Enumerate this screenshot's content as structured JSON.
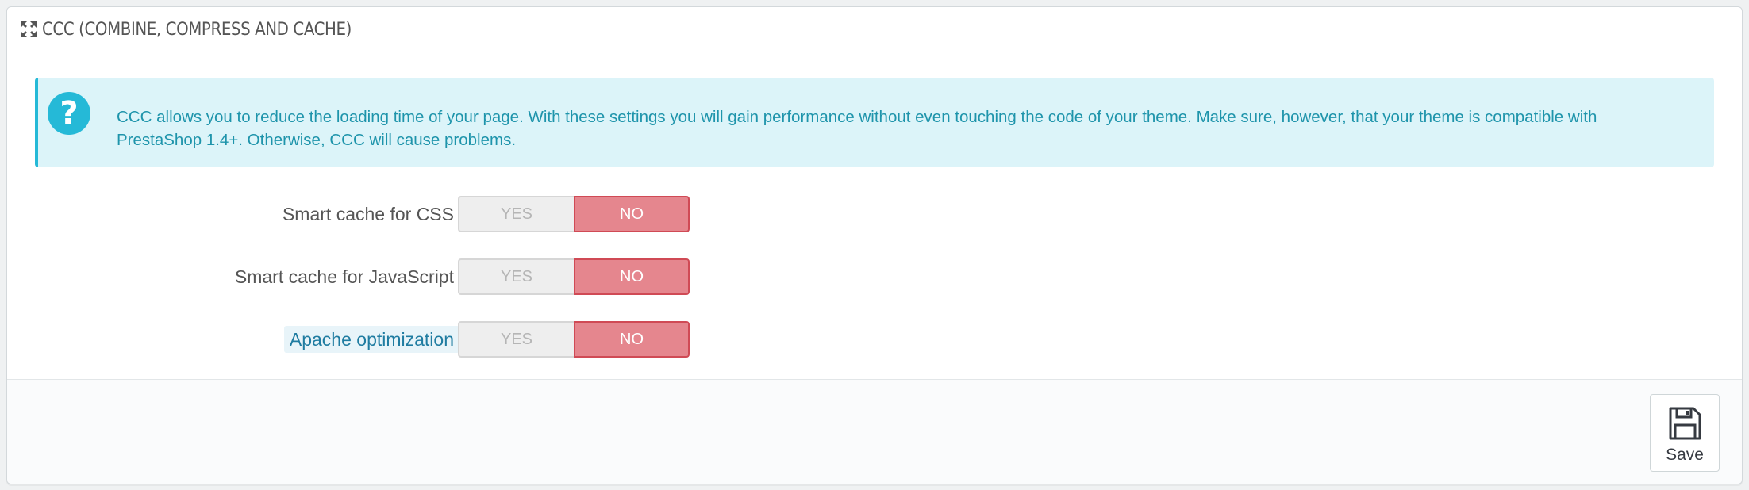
{
  "panel": {
    "title": "CCC (COMBINE, COMPRESS AND CACHE)",
    "title_icon": "expand-arrows-icon"
  },
  "alert": {
    "icon": "question-circle-icon",
    "text": "CCC allows you to reduce the loading time of your page. With these settings you will gain performance without even touching the code of your theme. Make sure, however, that your theme is compatible with PrestaShop 1.4+. Otherwise, CCC will cause problems."
  },
  "settings": [
    {
      "label": "Smart cache for CSS",
      "yes": "YES",
      "no": "NO",
      "value": "NO"
    },
    {
      "label": "Smart cache for JavaScript",
      "yes": "YES",
      "no": "NO",
      "value": "NO"
    },
    {
      "label": "Apache optimization",
      "yes": "YES",
      "no": "NO",
      "value": "NO"
    }
  ],
  "footer": {
    "save_label": "Save",
    "save_icon": "floppy-disk-icon"
  },
  "colors": {
    "info_accent": "#25b9d7",
    "info_background": "#dcf4f9",
    "info_text": "#1e94ab",
    "switch_off_background": "#e5868e",
    "switch_off_border": "#d04a55",
    "help_label": "#1f7ca1"
  }
}
